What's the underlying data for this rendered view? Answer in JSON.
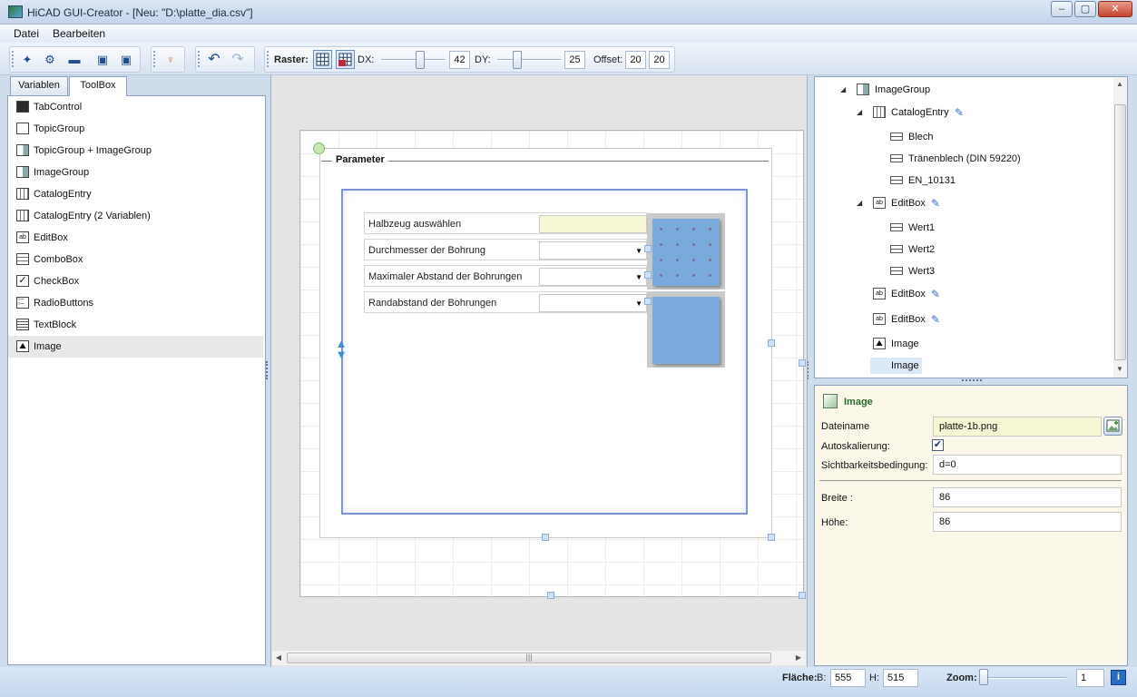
{
  "window": {
    "title": "HiCAD GUI-Creator - [Neu: \"D:\\platte_dia.csv\"]",
    "controls": {
      "minimize": "–",
      "maximize": "▢",
      "close": "✕"
    }
  },
  "menu": {
    "items": [
      "Datei",
      "Bearbeiten"
    ]
  },
  "toolbar": {
    "raster_label": "Raster:",
    "dx_label": "DX:",
    "dx_value": "42",
    "dy_label": "DY:",
    "dy_value": "25",
    "offset_label": "Offset:",
    "offset_x": "20",
    "offset_y": "20",
    "icons": {
      "new": "new-icon",
      "copy": "copy-settings-icon",
      "open": "open-folder-icon",
      "save": "save-icon",
      "save_as": "save-as-icon",
      "plugin": "plug-icon",
      "undo": "undo-icon",
      "redo": "redo-icon",
      "grid": "grid-icon",
      "snap": "snap-grid-icon"
    }
  },
  "left_tabs": [
    "Variablen",
    "ToolBox"
  ],
  "toolbox": {
    "items": [
      "TabControl",
      "TopicGroup",
      "TopicGroup + ImageGroup",
      "ImageGroup",
      "CatalogEntry",
      "CatalogEntry (2 Variablen)",
      "EditBox",
      "ComboBox",
      "CheckBox",
      "RadioButtons",
      "TextBlock",
      "Image"
    ],
    "selected": "Image"
  },
  "design": {
    "group_title": "Parameter",
    "rows": [
      {
        "label": "Halbzeug auswählen",
        "kind": "catalog"
      },
      {
        "label": "Durchmesser der Bohrung",
        "kind": "combo"
      },
      {
        "label": "Maximaler Abstand der Bohrungen",
        "kind": "combo"
      },
      {
        "label": "Randabstand der Bohrungen",
        "kind": "combo"
      }
    ],
    "scroll_grip": "|||"
  },
  "tree": {
    "items": [
      {
        "label": "ImageGroup",
        "icon": "image-group-icon",
        "expander": "◢",
        "edit": false
      },
      {
        "label": "CatalogEntry",
        "icon": "catalog-icon",
        "expander": "◢",
        "edit": true
      },
      {
        "label": "Blech",
        "icon": "field-icon",
        "expander": "",
        "edit": false
      },
      {
        "label": "Tränenblech (DIN 59220)",
        "icon": "field-icon",
        "expander": "",
        "edit": false
      },
      {
        "label": "EN_10131",
        "icon": "field-icon",
        "expander": "",
        "edit": false
      },
      {
        "label": "EditBox",
        "icon": "editbox-icon",
        "expander": "◢",
        "edit": true
      },
      {
        "label": "Wert1",
        "icon": "field-icon",
        "expander": "",
        "edit": false
      },
      {
        "label": "Wert2",
        "icon": "field-icon",
        "expander": "",
        "edit": false
      },
      {
        "label": "Wert3",
        "icon": "field-icon",
        "expander": "",
        "edit": false
      },
      {
        "label": "EditBox",
        "icon": "editbox-icon",
        "expander": "",
        "edit": true
      },
      {
        "label": "EditBox",
        "icon": "editbox-icon",
        "expander": "",
        "edit": true
      },
      {
        "label": "Image",
        "icon": "image-icon",
        "expander": "",
        "edit": false
      },
      {
        "label": "Image",
        "icon": "image-icon",
        "expander": "",
        "edit": false
      }
    ],
    "selected_index": 12
  },
  "properties": {
    "header": "Image",
    "filename_label": "Dateiname",
    "filename_value": "platte-1b.png",
    "autoscale_label": "Autoskalierung:",
    "autoscale_checked": true,
    "visibility_label": "Sichtbarkeitsbedingung:",
    "visibility_value": "d=0",
    "width_label": "Breite :",
    "width_value": "86",
    "height_label": "Höhe:",
    "height_value": "86"
  },
  "status": {
    "area_label": "Fläche:",
    "b_label": "B:",
    "b_value": "555",
    "h_label": "H:",
    "h_value": "515",
    "zoom_label": "Zoom:",
    "zoom_value": "1",
    "info_icon": "info-icon"
  }
}
